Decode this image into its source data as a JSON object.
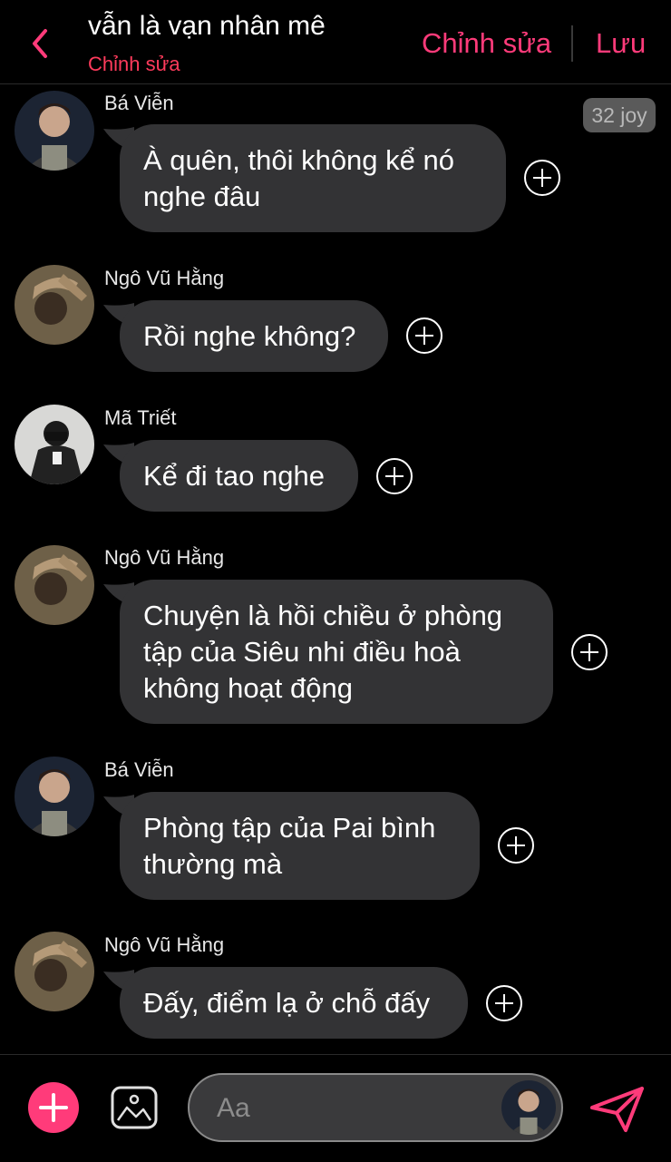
{
  "header": {
    "title": "vẫn là vạn nhân mê",
    "subtitle": "Chỉnh sửa",
    "edit_label": "Chỉnh sửa",
    "save_label": "Lưu"
  },
  "badge": "32 joy",
  "messages": [
    {
      "sender": "Bá Viễn",
      "lines": [
        "À quên, thôi không kể nó",
        "nghe đâu"
      ]
    },
    {
      "sender": "Ngô Vũ Hằng",
      "lines": [
        "Rồi nghe không?"
      ]
    },
    {
      "sender": "Mã Triết",
      "lines": [
        "Kể đi tao nghe"
      ]
    },
    {
      "sender": "Ngô Vũ Hằng",
      "lines": [
        "Chuyện là hồi chiều ở phòng",
        "tập của Siêu nhi điều hoà",
        "không hoạt động"
      ]
    },
    {
      "sender": "Bá Viễn",
      "lines": [
        "Phòng tập của Pai bình",
        "thường mà"
      ]
    },
    {
      "sender": "Ngô Vũ Hằng",
      "lines": [
        "Đấy, điểm lạ ở chỗ đấy"
      ]
    }
  ],
  "composer": {
    "placeholder": "Aa"
  },
  "colors": {
    "accent": "#ff3b7a",
    "bubble": "#333335",
    "background": "#000000"
  }
}
